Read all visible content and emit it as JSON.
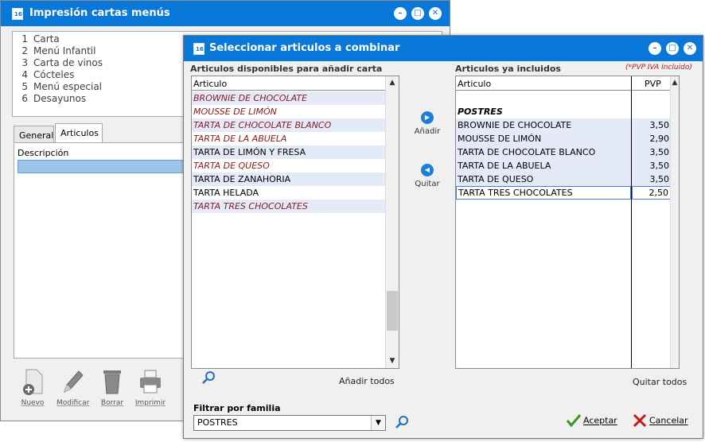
{
  "back_window": {
    "title": "Impresión cartas menús",
    "list": [
      {
        "num": "1",
        "label": "Carta"
      },
      {
        "num": "2",
        "label": "Menú Infantil"
      },
      {
        "num": "3",
        "label": "Carta de vinos"
      },
      {
        "num": "4",
        "label": "Cócteles"
      },
      {
        "num": "5",
        "label": "Menú especial"
      },
      {
        "num": "6",
        "label": "Desayunos"
      }
    ],
    "tabs": {
      "general": "General",
      "articulos": "Articulos"
    },
    "desc_header": "Descripción",
    "toolbar": {
      "nuevo": "Nuevo",
      "modificar": "Modificar",
      "borrar": "Borrar",
      "imprimir": "Imprimir"
    }
  },
  "dialog": {
    "title": "Seleccionar articulos a combinar",
    "available_label": "Articulos disponibles para añadir carta",
    "included_label": "Articulos ya incluidos",
    "pvp_note": "(*PVP IVA Incluido)",
    "available_header": "Articulo",
    "available_items": [
      {
        "name": "BROWNIE DE CHOCOLATE",
        "included": true
      },
      {
        "name": "MOUSSE DE LIMÓN",
        "included": true
      },
      {
        "name": "TARTA DE CHOCOLATE BLANCO",
        "included": true
      },
      {
        "name": "TARTA DE LA ABUELA",
        "included": true
      },
      {
        "name": "TARTA DE LIMÓN Y FRESA",
        "included": false
      },
      {
        "name": "TARTA DE QUESO",
        "included": true
      },
      {
        "name": "TARTA DE ZANAHORIA",
        "included": false
      },
      {
        "name": "TARTA HELADA",
        "included": false
      },
      {
        "name": "TARTA TRES CHOCOLATES",
        "included": true
      }
    ],
    "included_header": {
      "articulo": "Articulo",
      "pvp": "PVP"
    },
    "included_group": "POSTRES",
    "included_items": [
      {
        "name": "BROWNIE DE CHOCOLATE",
        "pvp": "3,50"
      },
      {
        "name": "MOUSSE DE LIMÓN",
        "pvp": "2,90"
      },
      {
        "name": "TARTA DE CHOCOLATE BLANCO",
        "pvp": "3,50"
      },
      {
        "name": "TARTA DE LA ABUELA",
        "pvp": "3,50"
      },
      {
        "name": "TARTA DE QUESO",
        "pvp": "3,50"
      },
      {
        "name": "TARTA TRES CHOCOLATES",
        "pvp": "2,50"
      }
    ],
    "add_label": "Añadir",
    "remove_label": "Quitar",
    "add_all": "Añadir todos",
    "remove_all": "Quitar todos",
    "filter_label": "Filtrar por familia",
    "filter_value": "POSTRES",
    "accept": "Aceptar",
    "cancel": "Cancelar"
  }
}
